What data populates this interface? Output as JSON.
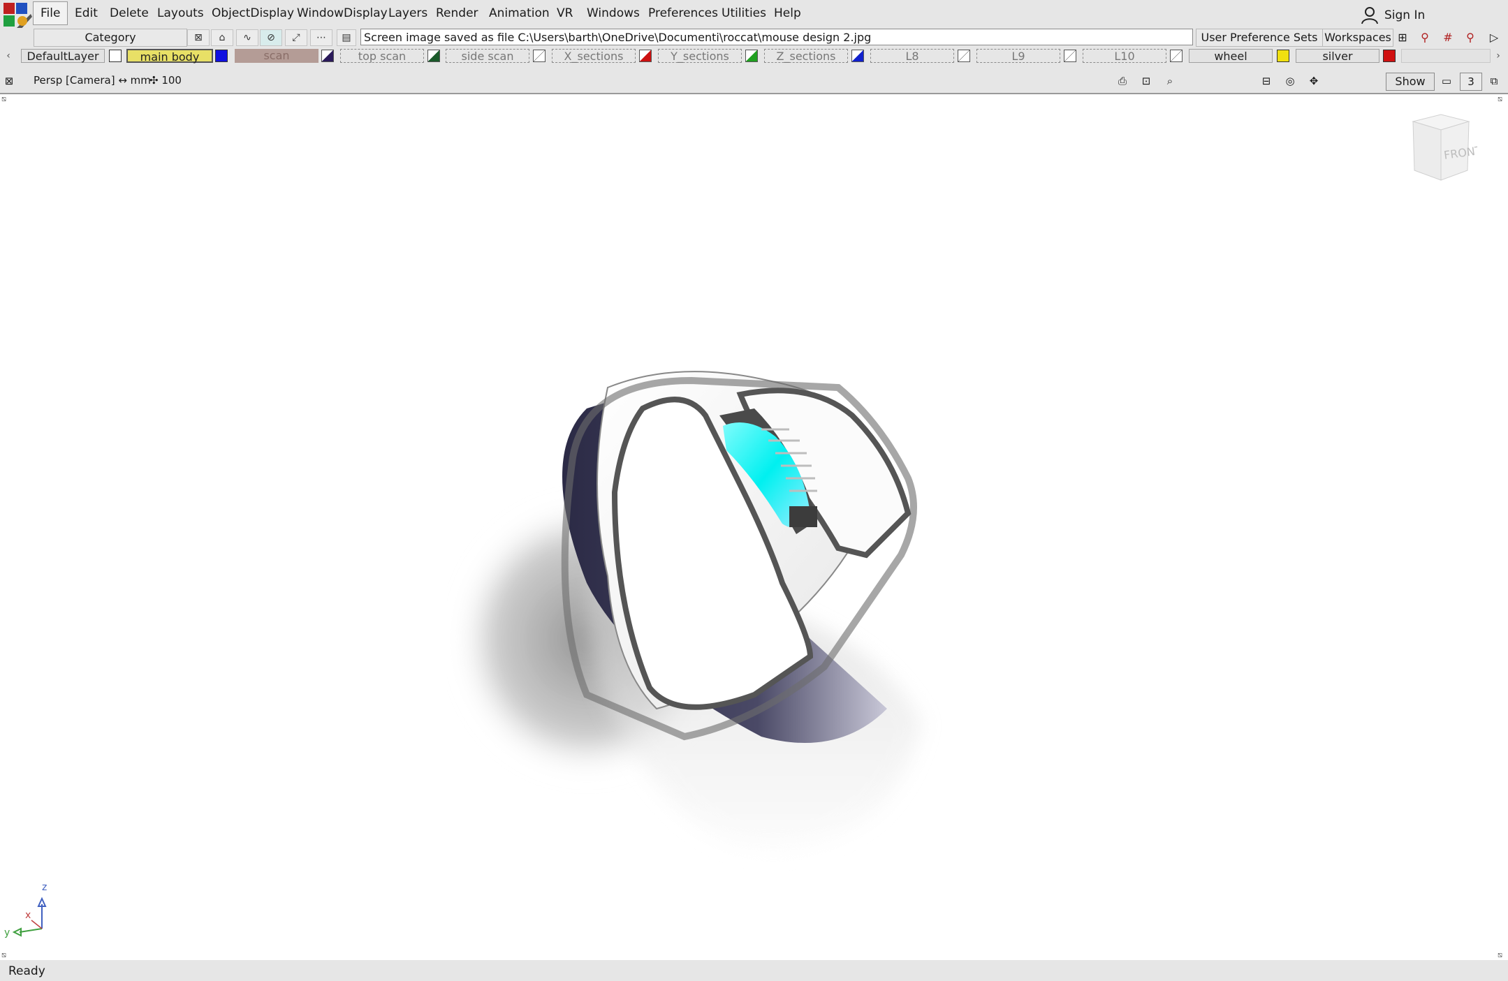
{
  "app": {
    "logo_label": "screen"
  },
  "menubar": {
    "items": [
      "File",
      "Edit",
      "Delete",
      "Layouts",
      "ObjectDisplay",
      "WindowDisplay",
      "Layers",
      "Render",
      "Animation",
      "VR",
      "Windows",
      "Preferences",
      "Utilities",
      "Help"
    ],
    "sign_in": "Sign In"
  },
  "toolbar": {
    "category": "Category",
    "message": "Screen image saved as file C:\\Users\\barth\\OneDrive\\Documenti\\roccat\\mouse design 2.jpg",
    "user_preference_sets": "User Preference Sets",
    "workspaces": "Workspaces"
  },
  "layers": [
    {
      "name": "DefaultLayer",
      "style": "solid",
      "swatch": "#ffffff"
    },
    {
      "name": "main body",
      "style": "selected",
      "color": "#e8e066",
      "swatch": "#1010e0"
    },
    {
      "name": "scan",
      "style": "filled",
      "color": "#b49c96",
      "swatch": "#2a1a5a"
    },
    {
      "name": "top scan",
      "style": "dashed",
      "swatch": "#1a5a2a"
    },
    {
      "name": "side scan",
      "style": "dashed",
      "swatch": "#ffffff"
    },
    {
      "name": "X_sections",
      "style": "dashed",
      "swatch": "#cc1010"
    },
    {
      "name": "Y_sections",
      "style": "dashed",
      "swatch": "#20a020"
    },
    {
      "name": "Z_sections",
      "style": "dashed",
      "swatch": "#1020cc"
    },
    {
      "name": "L8",
      "style": "dashed",
      "swatch": "#ffffff"
    },
    {
      "name": "L9",
      "style": "dashed",
      "swatch": "#ffffff"
    },
    {
      "name": "L10",
      "style": "dashed",
      "swatch": "#ffffff"
    },
    {
      "name": "wheel",
      "style": "solid",
      "swatch": "#f0e010"
    },
    {
      "name": "silver",
      "style": "solid",
      "swatch": "#d01010"
    }
  ],
  "status": {
    "camera": "Persp [Camera] ↔ mm",
    "grid": "✣ 100",
    "show": "Show",
    "count": "3"
  },
  "viewcube": {
    "front": "FRONT"
  },
  "axes": {
    "z": "z",
    "x": "x",
    "y": "y"
  },
  "footer": {
    "status": "Ready"
  },
  "icons": [
    "app-logo-icon",
    "user-icon",
    "viewcube",
    "axis-triad-icon"
  ]
}
